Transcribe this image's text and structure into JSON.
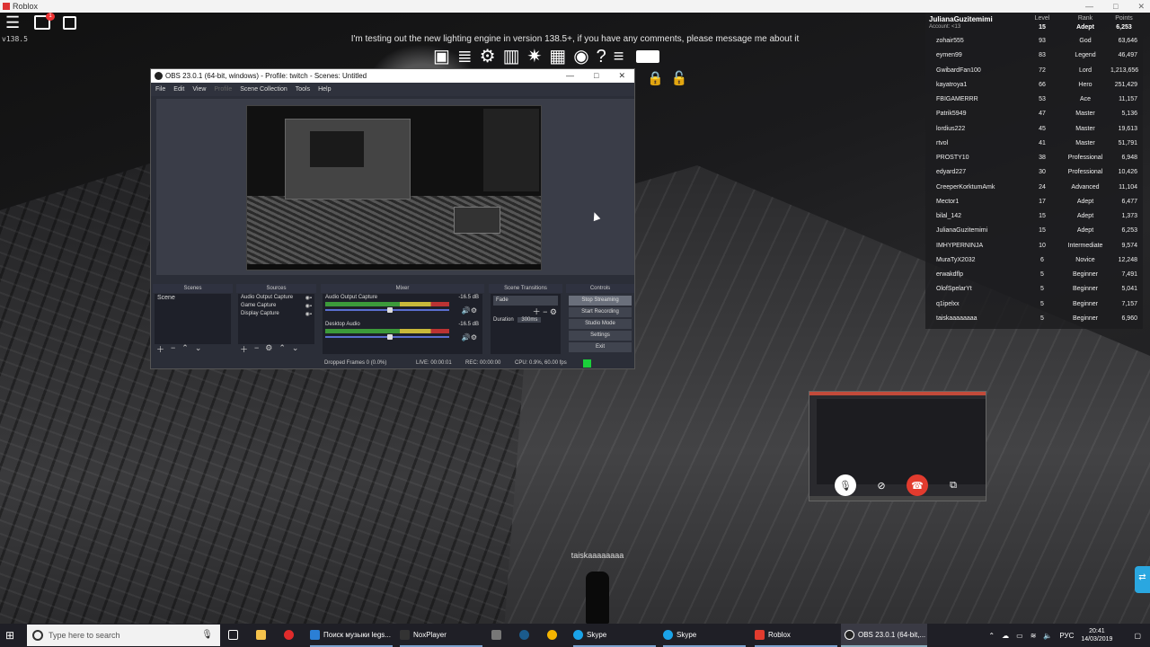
{
  "window": {
    "title": "Roblox",
    "buttons": [
      "—",
      "□",
      "✕"
    ]
  },
  "roblox": {
    "version": "v138.5",
    "announcement": "I'm testing out the new lighting engine in version 138.5+, if you have any comments, please message me about it",
    "chat_badge": "1"
  },
  "leaderboard": {
    "user": "JulianaGuzitemimi",
    "account_sub": "Account: <13",
    "headers": {
      "level": "Level",
      "rank": "Rank",
      "points": "Points"
    },
    "user_level": "15",
    "user_rank": "Adept",
    "user_points": "6,253",
    "rows": [
      {
        "name": "zohair555",
        "level": "93",
        "rank": "God",
        "points": "63,646"
      },
      {
        "name": "eymen99",
        "level": "83",
        "rank": "Legend",
        "points": "46,497"
      },
      {
        "name": "GwibardFan100",
        "level": "72",
        "rank": "Lord",
        "points": "1,213,656"
      },
      {
        "name": "kayatroya1",
        "level": "66",
        "rank": "Hero",
        "points": "251,429"
      },
      {
        "name": "FBIGAMERRR",
        "level": "53",
        "rank": "Ace",
        "points": "11,157"
      },
      {
        "name": "Patrik5949",
        "level": "47",
        "rank": "Master",
        "points": "5,136"
      },
      {
        "name": "lordius222",
        "level": "45",
        "rank": "Master",
        "points": "19,613"
      },
      {
        "name": "rtvol",
        "level": "41",
        "rank": "Master",
        "points": "51,791"
      },
      {
        "name": "PROSTY10",
        "level": "38",
        "rank": "Professional",
        "points": "6,948"
      },
      {
        "name": "edyard227",
        "level": "30",
        "rank": "Professional",
        "points": "10,426"
      },
      {
        "name": "CreeperKorktumAmk",
        "level": "24",
        "rank": "Advanced",
        "points": "11,104"
      },
      {
        "name": "Mector1",
        "level": "17",
        "rank": "Adept",
        "points": "6,477"
      },
      {
        "name": "bilal_142",
        "level": "15",
        "rank": "Adept",
        "points": "1,373"
      },
      {
        "name": "JulianaGuzitemimi",
        "level": "15",
        "rank": "Adept",
        "points": "6,253"
      },
      {
        "name": "IMHYPERNINJA",
        "level": "10",
        "rank": "Intermediate",
        "points": "9,574"
      },
      {
        "name": "MuraTyX2032",
        "level": "6",
        "rank": "Novice",
        "points": "12,248"
      },
      {
        "name": "erwakdflp",
        "level": "5",
        "rank": "Beginner",
        "points": "7,491"
      },
      {
        "name": "OlofSpelarYt",
        "level": "5",
        "rank": "Beginner",
        "points": "5,041"
      },
      {
        "name": "q1ipelxx",
        "level": "5",
        "rank": "Beginner",
        "points": "7,157"
      },
      {
        "name": "taiskaaaaaaaa",
        "level": "5",
        "rank": "Beginner",
        "points": "6,960"
      }
    ]
  },
  "obs": {
    "title": "OBS 23.0.1 (64-bit, windows) - Profile: twitch - Scenes: Untitled",
    "menu": [
      "File",
      "Edit",
      "View",
      "Profile",
      "Scene Collection",
      "Tools",
      "Help"
    ],
    "docks": {
      "scenes": {
        "title": "Scenes",
        "items": [
          "Scene"
        ]
      },
      "sources": {
        "title": "Sources",
        "items": [
          "Audio Output Capture",
          "Game Capture",
          "Display Capture"
        ]
      },
      "mixer": {
        "title": "Mixer",
        "channels": [
          {
            "name": "Audio Output Capture",
            "db": "-16.5 dB"
          },
          {
            "name": "Desktop Audio",
            "db": "-16.5 dB"
          }
        ]
      },
      "transitions": {
        "title": "Scene Transitions",
        "selected": "Fade",
        "duration_label": "Duration",
        "duration": "300ms"
      },
      "controls": {
        "title": "Controls",
        "buttons": [
          "Stop Streaming",
          "Start Recording",
          "Studio Mode",
          "Settings",
          "Exit"
        ]
      }
    },
    "status": {
      "dropped": "Dropped Frames 0 (0.0%)",
      "live": "LIVE: 00:00:01",
      "rec": "REC: 00:00:00",
      "cpu": "CPU: 0.9%, 60.00 fps"
    }
  },
  "player_tag": "taiskaaaaaaaa",
  "taskbar": {
    "search_placeholder": "Type here to search",
    "items": [
      {
        "label": "Поиск музыки legs..."
      },
      {
        "label": "NoxPlayer"
      },
      {
        "label": "Skype"
      },
      {
        "label": "Skype"
      },
      {
        "label": "Roblox"
      },
      {
        "label": "OBS 23.0.1 (64-bit,..."
      }
    ],
    "lang": "РУС",
    "time": "20:41",
    "date": "14/03/2019"
  }
}
